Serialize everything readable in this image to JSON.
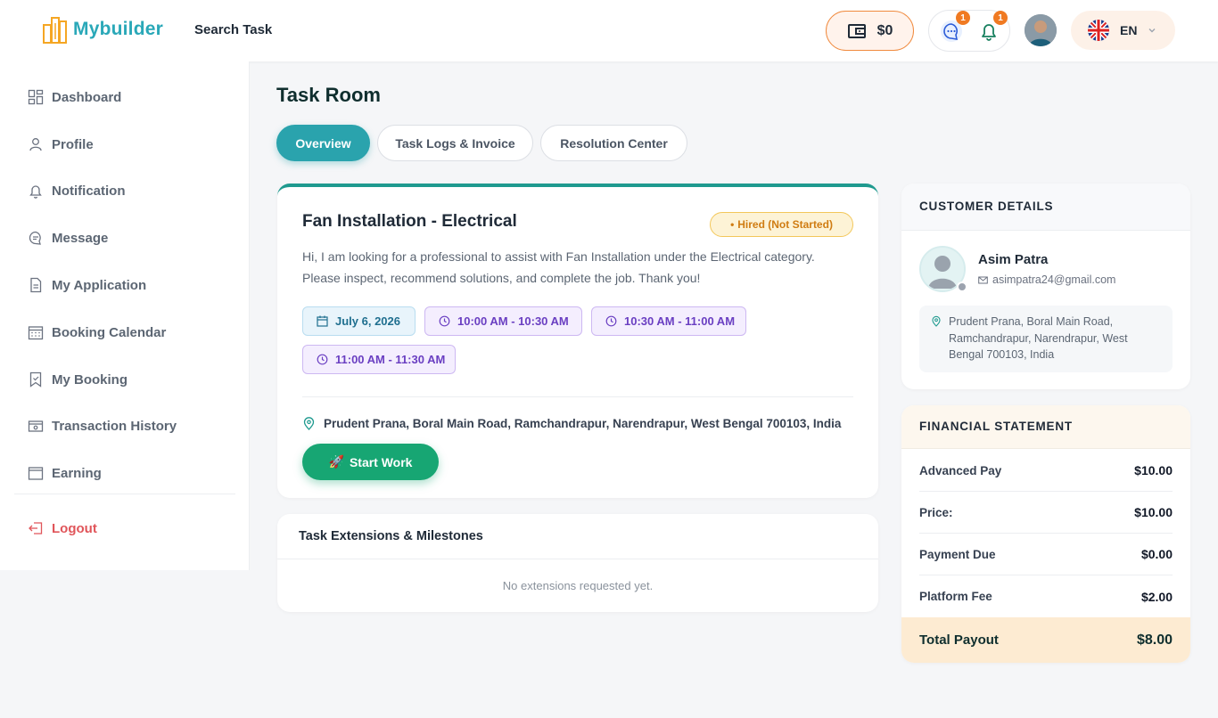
{
  "header": {
    "brand": "Mybuilder",
    "search_task": "Search Task",
    "wallet_balance": "$0",
    "message_badge": "1",
    "notification_badge": "1",
    "language": "EN"
  },
  "sidebar": {
    "items": [
      {
        "label": "Dashboard",
        "icon": "grid-icon"
      },
      {
        "label": "Profile",
        "icon": "user-icon"
      },
      {
        "label": "Notification",
        "icon": "bell-icon"
      },
      {
        "label": "Message",
        "icon": "chat-icon"
      },
      {
        "label": "My Application",
        "icon": "document-icon"
      },
      {
        "label": "Booking Calendar",
        "icon": "calendar-icon"
      },
      {
        "label": "My Booking",
        "icon": "bookmark-icon"
      },
      {
        "label": "Transaction History",
        "icon": "wallet-icon"
      },
      {
        "label": "Earning",
        "icon": "earning-icon"
      }
    ],
    "logout": "Logout"
  },
  "page": {
    "title": "Task Room",
    "tabs": [
      "Overview",
      "Task Logs & Invoice",
      "Resolution Center"
    ],
    "active_tab": "Overview"
  },
  "task": {
    "title": "Fan Installation - Electrical",
    "status": "Hired (Not Started)",
    "description": "Hi, I am looking for a professional to assist with Fan Installation under the Electrical category. Please inspect, recommend solutions, and complete the job. Thank you!",
    "date": "July 6, 2026",
    "time_slots": [
      "10:00 AM - 10:30 AM",
      "10:30 AM - 11:00 AM",
      "11:00 AM - 11:30 AM"
    ],
    "address": "Prudent Prana, Boral Main Road, Ramchandrapur, Narendrapur, West Bengal 700103, India",
    "start_button": "Start Work",
    "start_button_emoji": "🚀"
  },
  "extensions": {
    "title": "Task Extensions & Milestones",
    "empty_text": "No extensions requested yet."
  },
  "customer": {
    "section_title": "CUSTOMER DETAILS",
    "name": "Asim Patra",
    "email": "asimpatra24@gmail.com",
    "address": "Prudent Prana, Boral Main Road, Ramchandrapur, Narendrapur, West Bengal 700103, India"
  },
  "financial": {
    "section_title": "FINANCIAL STATEMENT",
    "rows": [
      {
        "label": "Advanced Pay",
        "value": "$10.00"
      },
      {
        "label": "Price:",
        "value": "$10.00"
      },
      {
        "label": "Payment Due",
        "value": "$0.00"
      },
      {
        "label": "Platform Fee",
        "value": "$2.00"
      }
    ],
    "total_label": "Total Payout",
    "total_value": "$8.00"
  },
  "colors": {
    "accent": "#2aa3ad",
    "brand": "#2aa8b8",
    "start_button": "#17a673",
    "logout": "#e0555a",
    "badge": "#f07a22"
  }
}
